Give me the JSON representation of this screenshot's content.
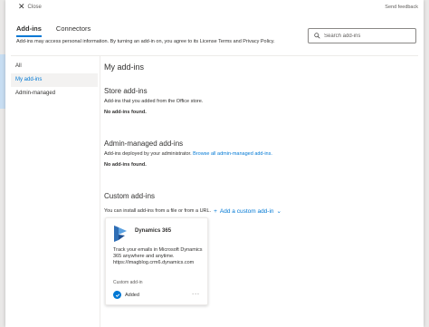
{
  "topbar": {
    "close_label": "Close",
    "feedback_label": "Send feedback"
  },
  "tabs": [
    {
      "label": "Add-ins"
    },
    {
      "label": "Connectors"
    }
  ],
  "notice": "Add-ins may access personal information. By turning an add-in on, you agree to its License Terms and Privacy Policy.",
  "search": {
    "placeholder": "Search add-ins"
  },
  "sidebar": {
    "items": [
      {
        "label": "All"
      },
      {
        "label": "My add-ins"
      },
      {
        "label": "Admin-managed"
      }
    ]
  },
  "main": {
    "title": "My add-ins",
    "store": {
      "heading": "Store add-ins",
      "desc": "Add-ins that you added from the Office store.",
      "empty": "No add-ins found."
    },
    "admin": {
      "heading": "Admin-managed add-ins",
      "desc_prefix": "Add-ins deployed by your administrator.",
      "browse_link": "Browse all admin-managed add-ins.",
      "empty": "No add-ins found."
    },
    "custom": {
      "heading": "Custom add-ins",
      "desc": "You can install add-ins from a file or from a URL.",
      "add_label": "Add a custom add-in"
    }
  },
  "card": {
    "title": "Dynamics 365",
    "desc": "Track your emails in Microsoft Dynamics 365 anywhere and anytime. https://imagblog.crm6.dynamics.com",
    "tag": "Custom add-in",
    "status": "Added",
    "more": "...",
    "icons": {
      "logo": "dynamics-365-logo",
      "status": "checkmark-icon"
    }
  },
  "colors": {
    "accent": "#0078d4",
    "text": "#323130",
    "muted": "#605e5c"
  }
}
